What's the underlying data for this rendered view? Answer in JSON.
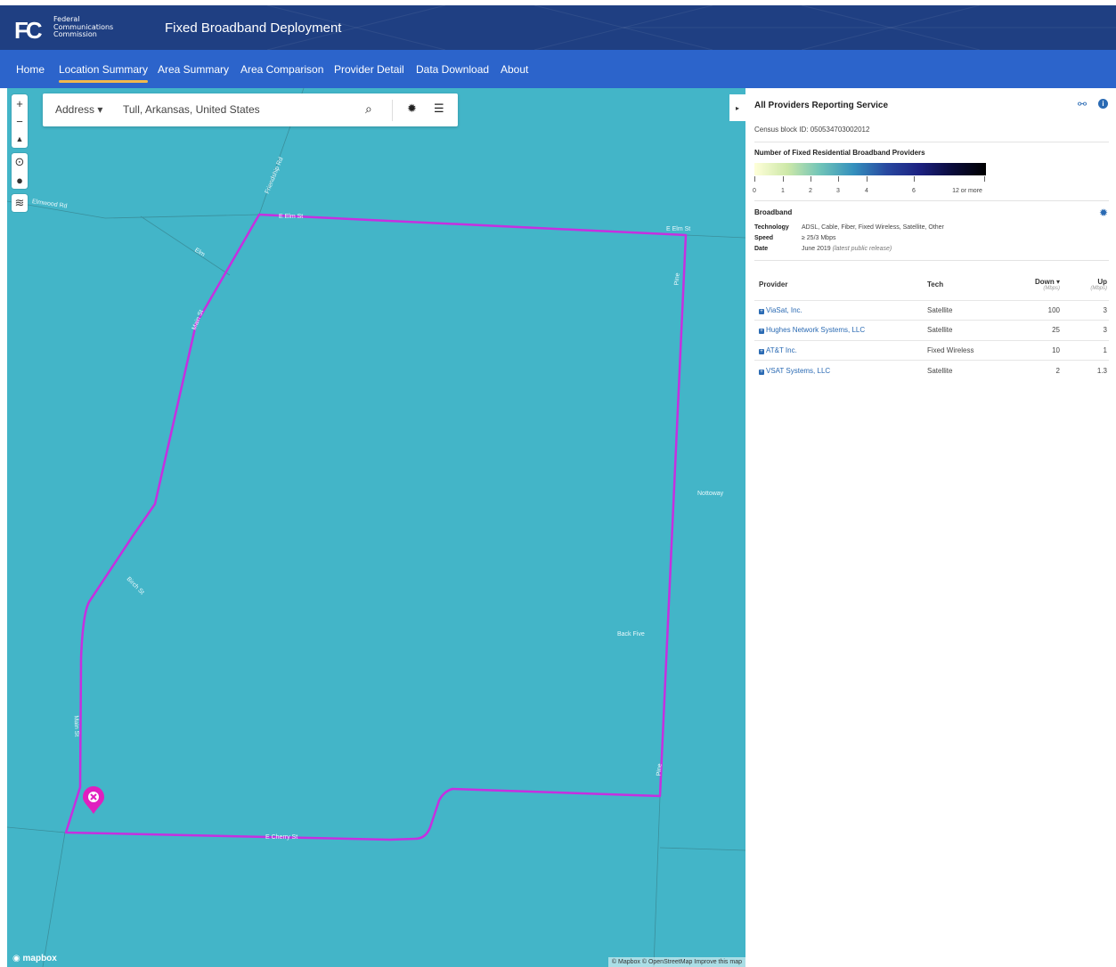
{
  "header": {
    "logo_mark": "FC",
    "logo_lines": [
      "Federal",
      "Communications",
      "Commission"
    ],
    "title": "Fixed Broadband Deployment"
  },
  "nav": {
    "items": [
      "Home",
      "Location Summary",
      "Area Summary",
      "Area Comparison",
      "Provider Detail",
      "Data Download",
      "About"
    ],
    "active": "Location Summary"
  },
  "search": {
    "type": "Address",
    "value": "Tull, Arkansas, United States"
  },
  "map": {
    "road_labels": {
      "friendship": "Friendship Rd",
      "elmwood": "Elmwood Rd",
      "elm_st_1": "E Elm St",
      "elm_st_2": "E Elm St",
      "elm": "Elm",
      "main_st_1": "Main St",
      "main_st_2": "Main St",
      "pine_1": "Pine",
      "pine_2": "Pine",
      "birch": "Birch St",
      "cherry": "E Cherry St",
      "nottoway": "Nottoway",
      "back_five": "Back Five"
    },
    "boundary_color": "#c62fe0",
    "marker_color": "#e01fbf",
    "mapbox_logo": "mapbox",
    "attribution": "© Mapbox © OpenStreetMap  Improve this map"
  },
  "panel": {
    "title": "All Providers Reporting Service",
    "census_block": "Census block ID: 050534703002012",
    "legend_title": "Number of Fixed Residential Broadband Providers",
    "legend_ticks": [
      "0",
      "1",
      "2",
      "3",
      "4",
      "6",
      "12 or more"
    ],
    "broadband_title": "Broadband",
    "meta": {
      "technology_key": "Technology",
      "technology_val": "ADSL, Cable, Fiber, Fixed Wireless, Satellite, Other",
      "speed_key": "Speed",
      "speed_val": "≥ 25/3 Mbps",
      "date_key": "Date",
      "date_val": "June 2019",
      "date_note": "(latest public release)"
    },
    "table": {
      "headers": {
        "provider": "Provider",
        "tech": "Tech",
        "down": "Down",
        "down_unit": "(Mbps)",
        "up": "Up",
        "up_unit": "(Mbps)"
      },
      "rows": [
        {
          "provider": "ViaSat, Inc.",
          "tech": "Satellite",
          "down": "100",
          "up": "3"
        },
        {
          "provider": "Hughes Network Systems, LLC",
          "tech": "Satellite",
          "down": "25",
          "up": "3"
        },
        {
          "provider": "AT&T Inc.",
          "tech": "Fixed Wireless",
          "down": "10",
          "up": "1"
        },
        {
          "provider": "VSAT Systems, LLC",
          "tech": "Satellite",
          "down": "2",
          "up": "1.3"
        }
      ]
    }
  }
}
